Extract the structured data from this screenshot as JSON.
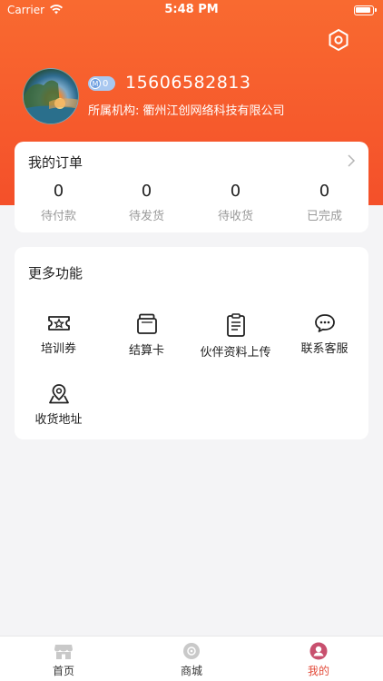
{
  "status_bar": {
    "carrier": "Carrier",
    "time": "5:48 PM"
  },
  "profile": {
    "member_level": "0",
    "phone": "15606582813",
    "org_label": "所属机构:",
    "org_name": "衢州江创网络科技有限公司"
  },
  "orders": {
    "title": "我的订单",
    "items": [
      {
        "count": "0",
        "label": "待付款"
      },
      {
        "count": "0",
        "label": "待发货"
      },
      {
        "count": "0",
        "label": "待收货"
      },
      {
        "count": "0",
        "label": "已完成"
      }
    ]
  },
  "more": {
    "title": "更多功能",
    "items": [
      {
        "icon": "ticket-icon",
        "label": "培训券"
      },
      {
        "icon": "wallet-icon",
        "label": "结算卡"
      },
      {
        "icon": "clipboard-icon",
        "label": "伙伴资料上传"
      },
      {
        "icon": "chat-icon",
        "label": "联系客服"
      },
      {
        "icon": "location-icon",
        "label": "收货地址"
      }
    ]
  },
  "tabbar": {
    "items": [
      {
        "label": "首页",
        "icon": "store-icon"
      },
      {
        "label": "商城",
        "icon": "mall-icon"
      },
      {
        "label": "我的",
        "icon": "profile-icon",
        "active": true
      }
    ]
  },
  "colors": {
    "accent": "#f4502a",
    "tab_active": "#e34b3a",
    "badge": "#a9c8f0"
  }
}
